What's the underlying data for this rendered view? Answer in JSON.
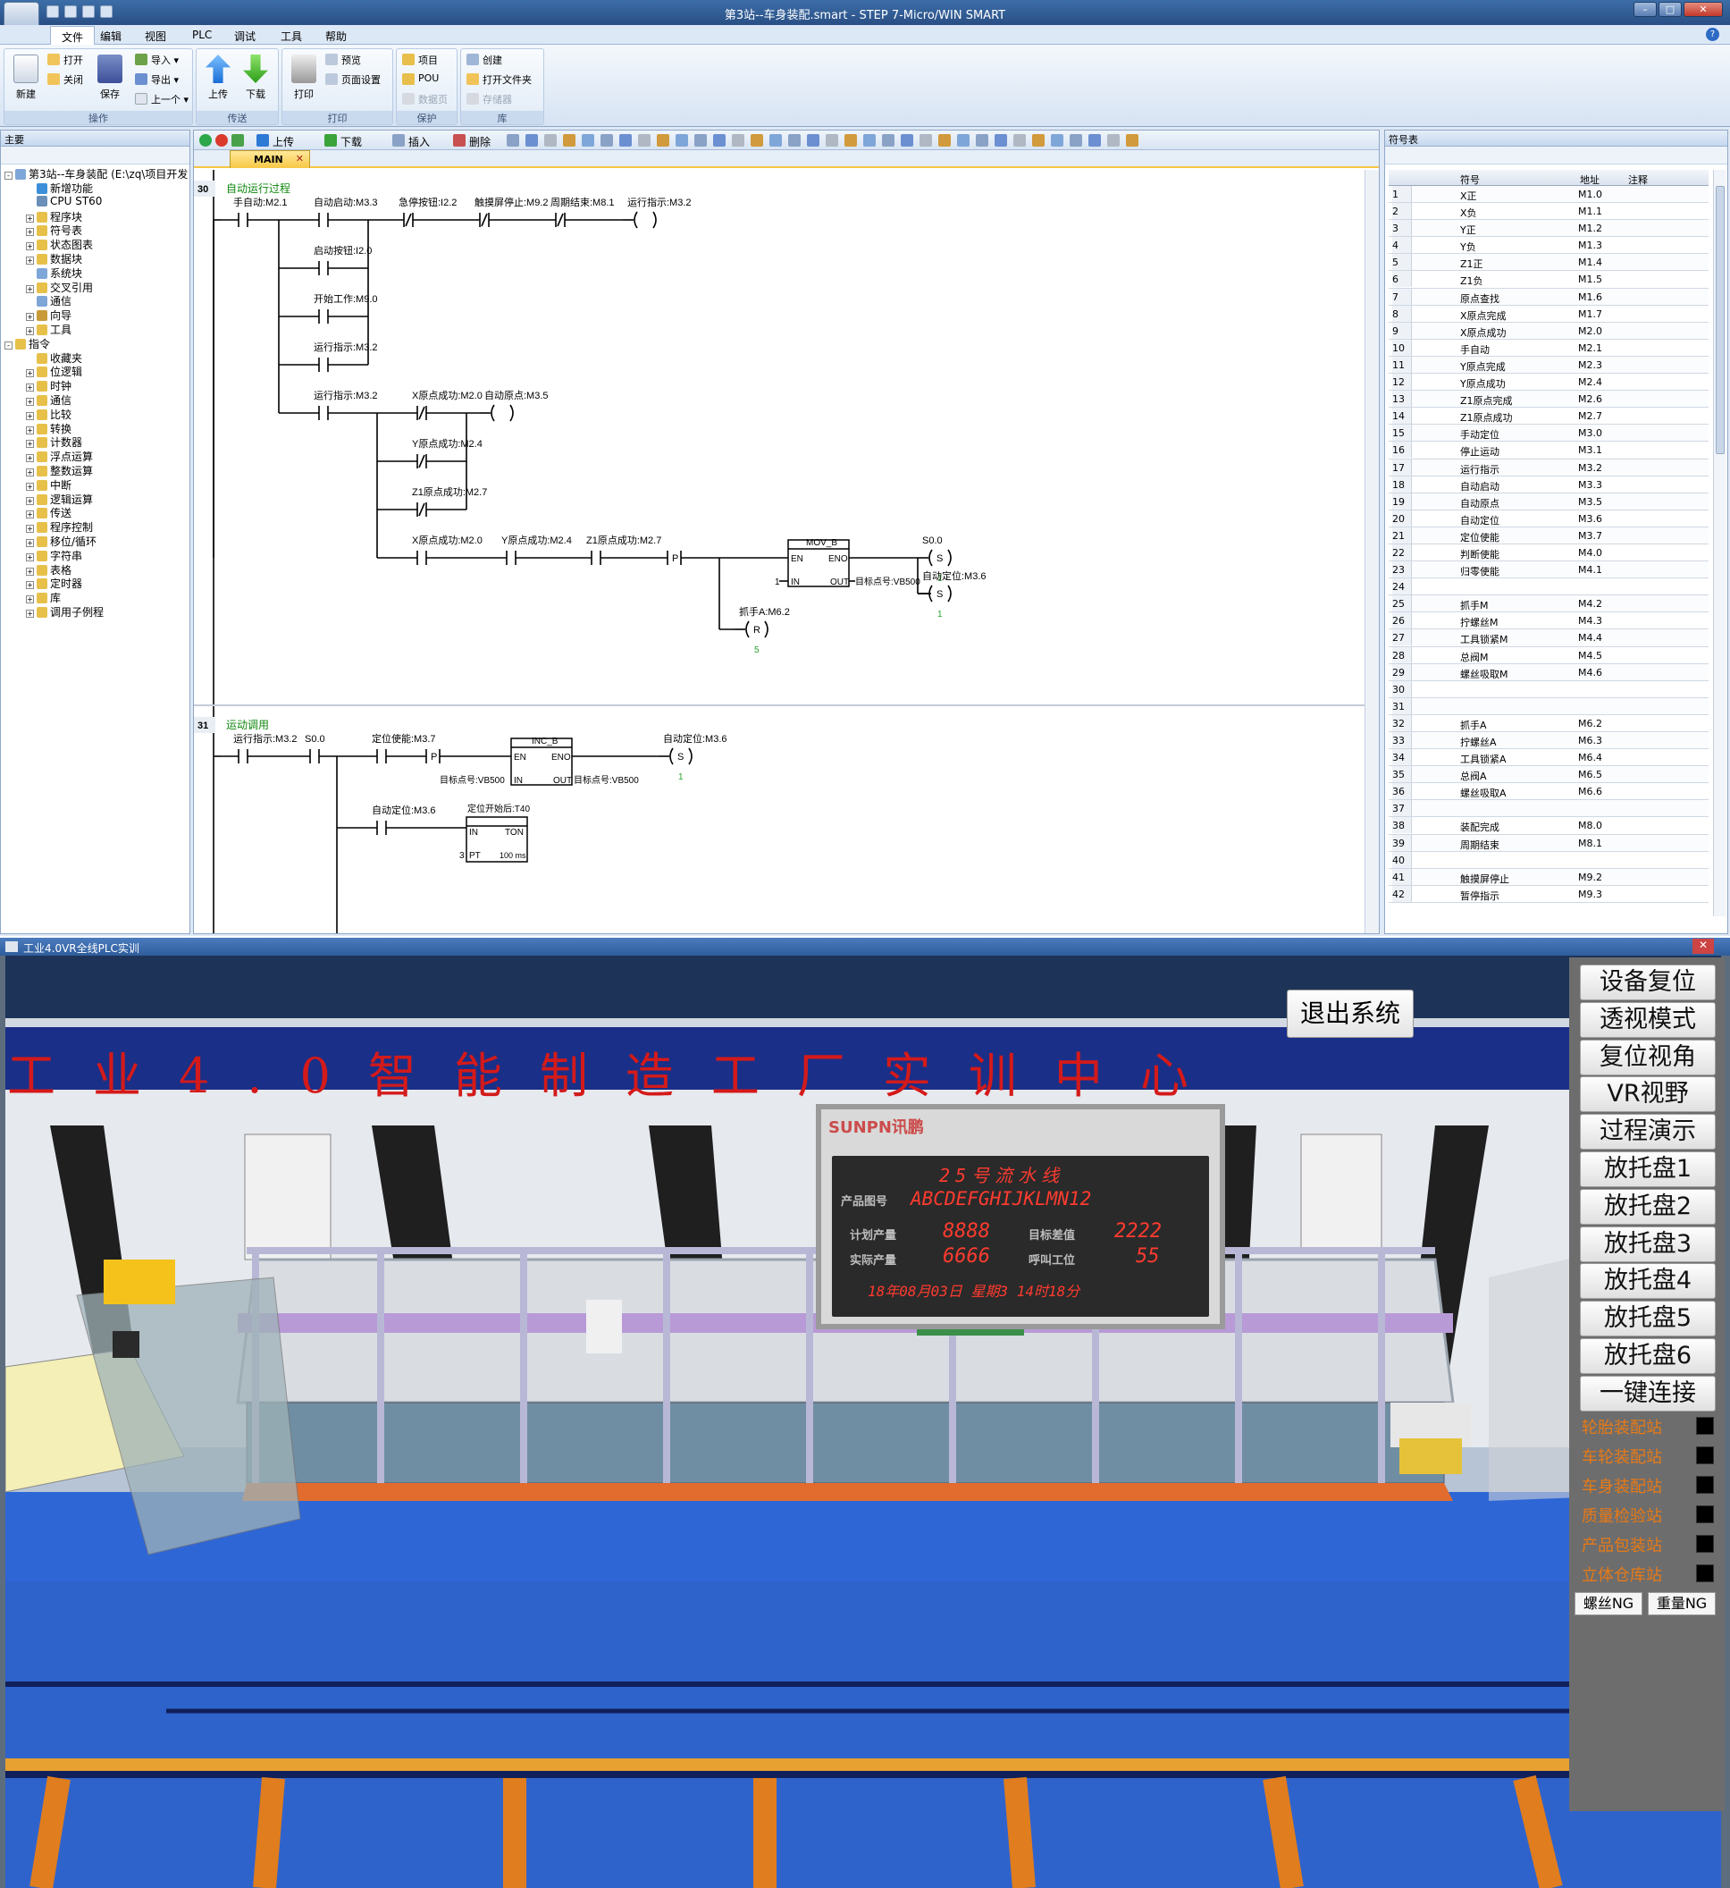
{
  "window": {
    "title": "第3站--车身装配.smart - STEP 7-Micro/WIN SMART"
  },
  "menu": [
    "文件",
    "编辑",
    "视图",
    "PLC",
    "调试",
    "工具",
    "帮助"
  ],
  "ribbon": {
    "groups": {
      "operate": "操作",
      "transfer": "传送",
      "print": "打印",
      "protect": "保护",
      "library": "库"
    },
    "new": "新建",
    "open": "打开",
    "close": "关闭",
    "save": "保存",
    "import": "导入",
    "export": "导出",
    "recent": "上一个",
    "upload": "上传",
    "download": "下载",
    "print_btn": "打印",
    "preview": "预览",
    "page_setup": "页面设置",
    "project": "项目",
    "pou": "POU",
    "datapage": "数据页",
    "create": "创建",
    "open_folder": "打开文件夹",
    "memory": "存储器"
  },
  "left_pane": {
    "title": "主要",
    "root": "第3站--车身装配 (E:\\zq\\项目开发",
    "items": [
      "新增功能",
      "CPU ST60",
      "程序块",
      "符号表",
      "状态图表",
      "数据块",
      "系统块",
      "交叉引用",
      "通信",
      "向导",
      "工具",
      "指令",
      "收藏夹",
      "位逻辑",
      "时钟",
      "通信",
      "比较",
      "转换",
      "计数器",
      "浮点运算",
      "整数运算",
      "中断",
      "逻辑运算",
      "传送",
      "程序控制",
      "移位/循环",
      "字符串",
      "表格",
      "定时器",
      "库",
      "调用子例程"
    ]
  },
  "editor": {
    "toolbar": {
      "upload": "上传",
      "download": "下载",
      "insert": "插入",
      "delete": "删除"
    },
    "tab": "MAIN",
    "network30": {
      "num": "30",
      "comment": "自动运行过程",
      "row1": [
        "手自动:M2.1",
        "自动启动:M3.3",
        "急停按钮:I2.2",
        "触摸屏停止:M9.2",
        "周期结束:M8.1",
        "运行指示:M3.2"
      ],
      "par": [
        "启动按钮:I2.0",
        "开始工作:M9.0",
        "运行指示:M3.2"
      ],
      "sub1": [
        "运行指示:M3.2",
        "X原点成功:M2.0",
        "自动原点:M3.5"
      ],
      "sub2": [
        "Y原点成功:M2.4",
        "Z1原点成功:M2.7"
      ],
      "row4": [
        "X原点成功:M2.0",
        "Y原点成功:M2.4",
        "Z1原点成功:M2.7"
      ],
      "p": "P",
      "mov": {
        "name": "MOV_B",
        "en": "EN",
        "eno": "ENO",
        "in": "IN",
        "out": "OUT",
        "in_val": "1",
        "out_val": "目标点号:VB500"
      },
      "s1": {
        "label": "S0.0",
        "type": "S",
        "n": "1"
      },
      "s2": {
        "label": "自动定位:M3.6",
        "type": "S",
        "n": "1"
      },
      "r1": {
        "label": "抓手A:M6.2",
        "type": "R",
        "n": "5"
      }
    },
    "network31": {
      "num": "31",
      "comment": "运动调用",
      "row1": [
        "运行指示:M3.2",
        "S0.0",
        "定位使能:M3.7"
      ],
      "p": "P",
      "inc": {
        "name": "INC_B",
        "en": "EN",
        "eno": "ENO",
        "in": "IN",
        "out": "OUT",
        "in_val": "目标点号:VB500",
        "out_val": "目标点号:VB500"
      },
      "s1": {
        "label": "自动定位:M3.6",
        "type": "S",
        "n": "1"
      },
      "row2": "自动定位:M3.6",
      "ton": {
        "label": "定位开始后:T40",
        "in": "IN",
        "type": "TON",
        "pt": "PT",
        "pt_val": "3",
        "res": "100 ms"
      }
    }
  },
  "symbols": {
    "title": "符号表",
    "headers": [
      "符号",
      "地址",
      "注释"
    ],
    "rows": [
      [
        "1",
        "X正",
        "M1.0"
      ],
      [
        "2",
        "X负",
        "M1.1"
      ],
      [
        "3",
        "Y正",
        "M1.2"
      ],
      [
        "4",
        "Y负",
        "M1.3"
      ],
      [
        "5",
        "Z1正",
        "M1.4"
      ],
      [
        "6",
        "Z1负",
        "M1.5"
      ],
      [
        "7",
        "原点查找",
        "M1.6"
      ],
      [
        "8",
        "X原点完成",
        "M1.7"
      ],
      [
        "9",
        "X原点成功",
        "M2.0"
      ],
      [
        "10",
        "手自动",
        "M2.1"
      ],
      [
        "11",
        "Y原点完成",
        "M2.3"
      ],
      [
        "12",
        "Y原点成功",
        "M2.4"
      ],
      [
        "13",
        "Z1原点完成",
        "M2.6"
      ],
      [
        "14",
        "Z1原点成功",
        "M2.7"
      ],
      [
        "15",
        "手动定位",
        "M3.0"
      ],
      [
        "16",
        "停止运动",
        "M3.1"
      ],
      [
        "17",
        "运行指示",
        "M3.2"
      ],
      [
        "18",
        "自动启动",
        "M3.3"
      ],
      [
        "19",
        "自动原点",
        "M3.5"
      ],
      [
        "20",
        "自动定位",
        "M3.6"
      ],
      [
        "21",
        "定位使能",
        "M3.7"
      ],
      [
        "22",
        "判断使能",
        "M4.0"
      ],
      [
        "23",
        "归零使能",
        "M4.1"
      ],
      [
        "24",
        "",
        ""
      ],
      [
        "25",
        "抓手M",
        "M4.2"
      ],
      [
        "26",
        "拧螺丝M",
        "M4.3"
      ],
      [
        "27",
        "工具锁紧M",
        "M4.4"
      ],
      [
        "28",
        "总阀M",
        "M4.5"
      ],
      [
        "29",
        "螺丝吸取M",
        "M4.6"
      ],
      [
        "30",
        "",
        ""
      ],
      [
        "31",
        "",
        ""
      ],
      [
        "32",
        "抓手A",
        "M6.2"
      ],
      [
        "33",
        "拧螺丝A",
        "M6.3"
      ],
      [
        "34",
        "工具锁紧A",
        "M6.4"
      ],
      [
        "35",
        "总阀A",
        "M6.5"
      ],
      [
        "36",
        "螺丝吸取A",
        "M6.6"
      ],
      [
        "37",
        "",
        ""
      ],
      [
        "38",
        "装配完成",
        "M8.0"
      ],
      [
        "39",
        "周期结束",
        "M8.1"
      ],
      [
        "40",
        "",
        ""
      ],
      [
        "41",
        "触摸屏停止",
        "M9.2"
      ],
      [
        "42",
        "暂停指示",
        "M9.3"
      ]
    ]
  },
  "vr": {
    "title": "工业4.0VR全线PLC实训",
    "exit": "退出系统",
    "banner": "工业4.0智能制造工厂实训中心",
    "sign": {
      "logo": "SUNPN讯鹏",
      "line": "25号流水线",
      "product_label": "产品图号",
      "product": "ABCDEFGHIJKLMN12",
      "plan_label": "计划产量",
      "plan": "8888",
      "diff_label": "目标差值",
      "diff": "2222",
      "actual_label": "实际产量",
      "actual": "6666",
      "call_label": "呼叫工位",
      "call": "55",
      "date": "18年08月03日 星期3 14时18分"
    },
    "buttons": [
      "设备复位",
      "透视模式",
      "复位视角",
      "VR视野",
      "过程演示",
      "放托盘1",
      "放托盘2",
      "放托盘3",
      "放托盘4",
      "放托盘5",
      "放托盘6",
      "一键连接"
    ],
    "stations": [
      "轮胎装配站",
      "车轮装配站",
      "车身装配站",
      "质量检验站",
      "产品包装站",
      "立体仓库站"
    ],
    "ng": [
      "螺丝NG",
      "重量NG"
    ],
    "colors": {
      "station_text": "#e87a16",
      "banner": "#d41a1a",
      "floor": "#2e66d6"
    }
  }
}
